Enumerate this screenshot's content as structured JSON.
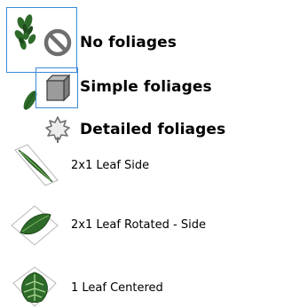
{
  "menu": {
    "items": [
      {
        "label": "No foliages",
        "icon": "no-symbol-icon"
      },
      {
        "label": "Simple foliages",
        "icon": "gray-cube-icon"
      },
      {
        "label": "Detailed foliages",
        "icon": "leaf-outline-icon"
      }
    ]
  },
  "assets": {
    "items": [
      {
        "label": "2x1 Leaf Side",
        "icon": "leaf-card-side-thumbnail"
      },
      {
        "label": "2x1 Leaf Rotated - Side",
        "icon": "leaf-card-rotated-thumbnail"
      },
      {
        "label": "1 Leaf Centered",
        "icon": "leaf-centered-thumbnail"
      }
    ]
  },
  "colors": {
    "selection_border": "#3a8ad6",
    "leaf_green": "#2e6b2a",
    "leaf_dark": "#1f4a1c",
    "card_border": "#b8b8b8"
  }
}
